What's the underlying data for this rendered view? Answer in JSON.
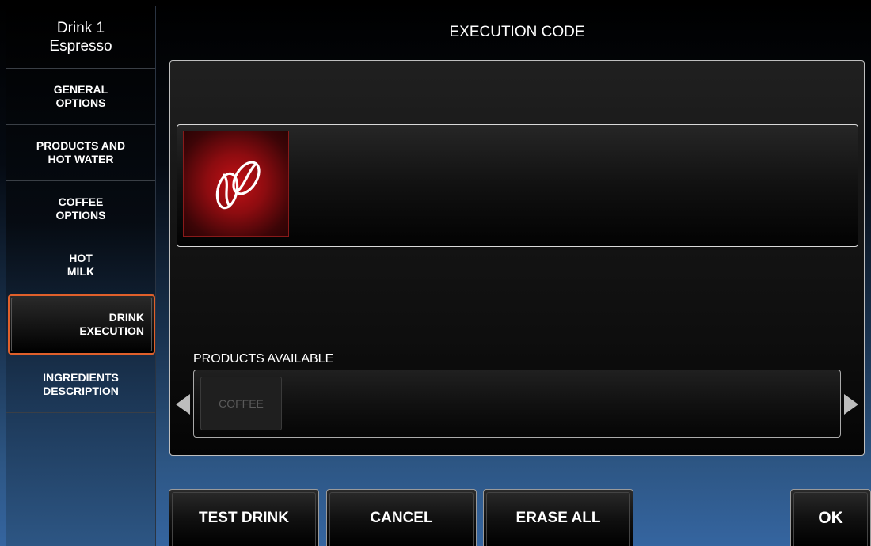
{
  "sidebar": {
    "title_line1": "Drink 1",
    "title_line2": "Espresso",
    "items": [
      {
        "line1": "GENERAL",
        "line2": "OPTIONS"
      },
      {
        "line1": "PRODUCTS AND",
        "line2": "HOT WATER"
      },
      {
        "line1": "COFFEE",
        "line2": "OPTIONS"
      },
      {
        "line1": "HOT",
        "line2": "MILK"
      },
      {
        "line1": "DRINK",
        "line2": "EXECUTION",
        "active": true
      },
      {
        "line1": "INGREDIENTS",
        "line2": "DESCRIPTION"
      }
    ]
  },
  "header": {
    "title": "EXECUTION CODE"
  },
  "execution_code": {
    "steps": [
      {
        "icon": "coffee-beans-icon",
        "color": "#c41015"
      }
    ]
  },
  "products": {
    "label": "PRODUCTS AVAILABLE",
    "items": [
      {
        "label": "COFFEE"
      }
    ]
  },
  "footer": {
    "test_drink": "TEST DRINK",
    "cancel": "CANCEL",
    "erase_all": "ERASE ALL",
    "ok": "OK"
  },
  "colors": {
    "active_border": "#e0602b",
    "tile_red": "#c41015"
  }
}
